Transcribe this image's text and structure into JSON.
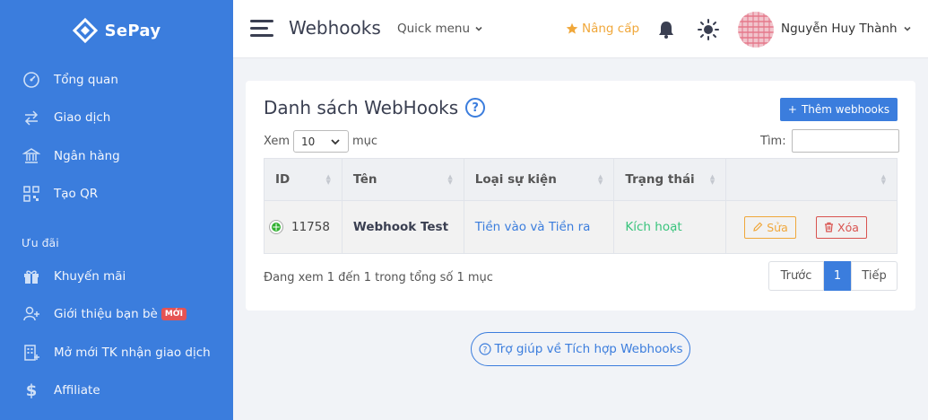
{
  "sidebar": {
    "brand": "SePay",
    "items": [
      {
        "label": "Tổng quan",
        "icon": "dashboard-gauge-icon"
      },
      {
        "label": "Giao dịch",
        "icon": "transfer-arrows-icon"
      },
      {
        "label": "Ngân hàng",
        "icon": "bank-icon"
      },
      {
        "label": "Tạo QR",
        "icon": "qr-code-icon"
      }
    ],
    "section_label": "Ưu đãi",
    "items2": [
      {
        "label": "Khuyến mãi",
        "icon": "gift-icon"
      },
      {
        "label": "Giới thiệu bạn bè",
        "icon": "add-user-icon",
        "badge": "MỚI"
      },
      {
        "label": "Mở mới TK nhận giao dịch",
        "icon": "building-icon"
      },
      {
        "label": "Affiliate",
        "icon": "dollar-icon"
      }
    ]
  },
  "header": {
    "title": "Webhooks",
    "quick_menu": "Quick menu",
    "upgrade": "Nâng cấp",
    "user_name": "Nguyễn Huy Thành"
  },
  "card": {
    "title": "Danh sách WebHooks",
    "help_glyph": "?",
    "add_button": "Thêm webhooks",
    "length_label_before": "Xem",
    "length_value": "10",
    "length_label_after": "mục",
    "search_label": "Tìm:",
    "search_value": "",
    "columns": [
      "ID",
      "Tên",
      "Loại sự kiện",
      "Trạng thái",
      ""
    ],
    "rows": [
      {
        "id": "11758",
        "name": "Webhook Test",
        "event_type": "Tiền vào và Tiền ra",
        "status": "Kích hoạt",
        "edit_label": "Sửa",
        "delete_label": "Xóa"
      }
    ],
    "info": "Đang xem 1 đến 1 trong tổng số 1 mục",
    "pager": {
      "prev": "Trước",
      "current": "1",
      "next": "Tiếp"
    }
  },
  "help_link": "Trợ giúp về Tích hợp Webhooks",
  "colors": {
    "primary": "#3b7ddd",
    "warning": "#f0a73a",
    "danger": "#d9534f",
    "success": "#3ac47d"
  }
}
